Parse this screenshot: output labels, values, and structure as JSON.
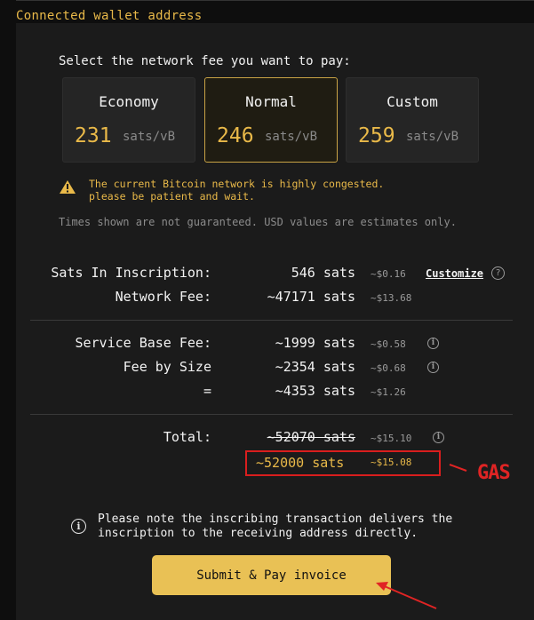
{
  "header": {
    "wallet_link": "Connected wallet address"
  },
  "fee_select": {
    "prompt": "Select the network fee you want to pay:",
    "options": [
      {
        "name": "Economy",
        "value": "231",
        "unit": "sats/vB",
        "selected": false
      },
      {
        "name": "Normal",
        "value": "246",
        "unit": "sats/vB",
        "selected": true
      },
      {
        "name": "Custom",
        "value": "259",
        "unit": "sats/vB",
        "selected": false
      }
    ]
  },
  "warning": {
    "line1": "The current Bitcoin network is highly congested.",
    "line2": "please be patient and wait."
  },
  "disclaimer": "Times shown are not guaranteed. USD values are estimates only.",
  "summary": {
    "inscription": {
      "label": "Sats In Inscription:",
      "sats": "546 sats",
      "usd": "~$0.16",
      "customize": "Customize",
      "help": "?"
    },
    "network_fee": {
      "label": "Network Fee:",
      "sats": "~47171 sats",
      "usd": "~$13.68"
    },
    "service_base_fee": {
      "label": "Service Base Fee:",
      "sats": "~1999 sats",
      "usd": "~$0.58"
    },
    "fee_by_size": {
      "label": "Fee by Size",
      "sats": "~2354 sats",
      "usd": "~$0.68"
    },
    "subtotal": {
      "label": "=",
      "sats": "~4353 sats",
      "usd": "~$1.26"
    },
    "total": {
      "label": "Total:",
      "old_sats": "~52070 sats",
      "old_usd": "~$15.10",
      "sats": "~52000 sats",
      "usd": "~$15.08"
    }
  },
  "annotation": {
    "gas_label": "GAS",
    "color": "#e02424"
  },
  "note": {
    "line1": "Please note the inscribing transaction delivers the",
    "line2": "inscription to the receiving address directly."
  },
  "submit_label": "Submit & Pay invoice",
  "colors": {
    "accent": "#e9b949",
    "button": "#e9c155",
    "background": "#1b1b1b"
  }
}
